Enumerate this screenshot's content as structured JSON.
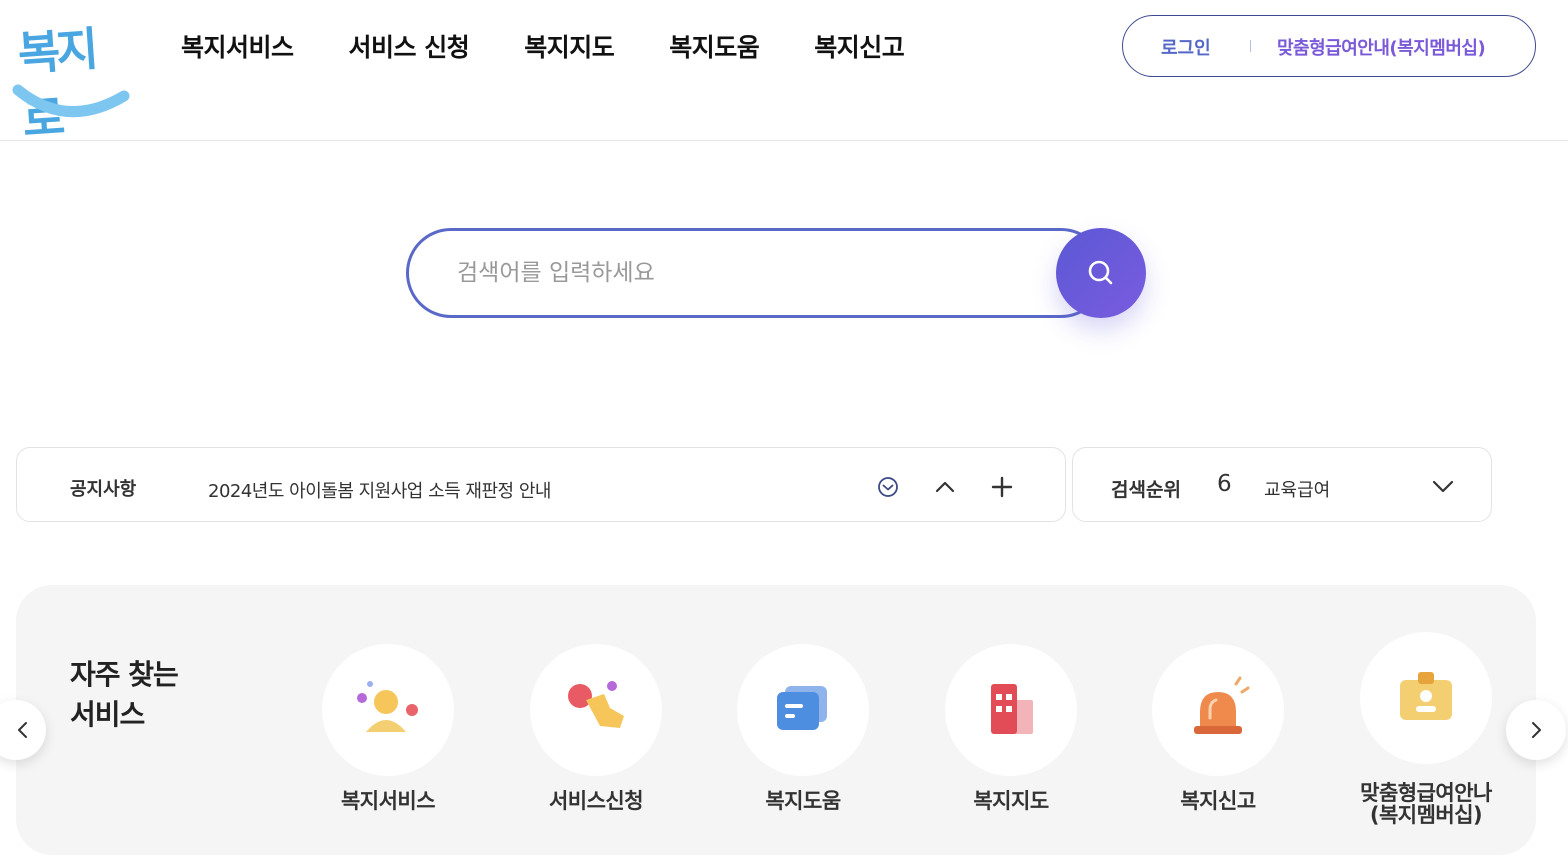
{
  "logo": {
    "text": "복지로"
  },
  "nav": [
    {
      "label": "복지서비스"
    },
    {
      "label": "서비스 신청"
    },
    {
      "label": "복지지도"
    },
    {
      "label": "복지도움"
    },
    {
      "label": "복지신고"
    }
  ],
  "auth": {
    "login": "로그인",
    "member": "맞춤형급여안내(복지멤버십)"
  },
  "search": {
    "placeholder": "검색어를 입력하세요"
  },
  "notice": {
    "label": "공지사항",
    "text": "2024년도 아이돌봄 지원사업 소득 재판정 안내"
  },
  "ranking": {
    "label": "검색순위",
    "rank": "6",
    "term": "교육급여"
  },
  "favorites": {
    "title_line1": "자주 찾는",
    "title_line2": "서비스",
    "items": [
      {
        "label": "복지서비스",
        "icon": "person-icon"
      },
      {
        "label": "서비스신청",
        "icon": "tap-hand-icon"
      },
      {
        "label": "복지도움",
        "icon": "document-icon"
      },
      {
        "label": "복지지도",
        "icon": "building-icon"
      },
      {
        "label": "복지신고",
        "icon": "siren-icon"
      },
      {
        "label_line1": "맞춤형급여안나",
        "label_line2": "(복지멤버십)",
        "icon": "id-card-icon"
      }
    ]
  },
  "colors": {
    "brand_blue": "#4aa6e0",
    "accent_indigo": "#5a68c8",
    "accent_purple": "#7a5ad9"
  }
}
